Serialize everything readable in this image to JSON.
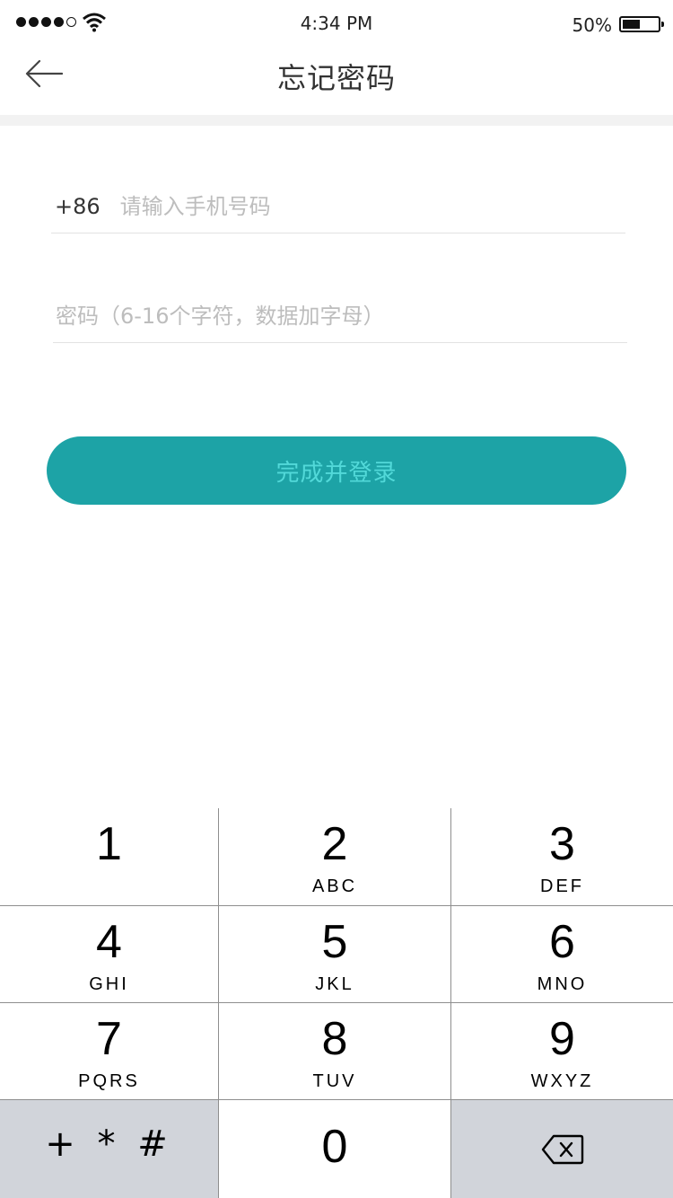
{
  "status_bar": {
    "time": "4:34 PM",
    "battery_percent": "50%",
    "battery_level": 0.5,
    "signal_bars_filled": 4,
    "signal_bars_total": 5
  },
  "nav": {
    "title": "忘记密码",
    "back_icon": "arrow-left-icon"
  },
  "form": {
    "phone_prefix": "+86",
    "phone_placeholder": "请输入手机号码",
    "phone_value": "",
    "password_placeholder": "密码（6-16个字符，数据加字母）",
    "password_value": "",
    "submit_label": "完成并登录"
  },
  "keypad": {
    "keys": [
      {
        "num": "1",
        "letters": ""
      },
      {
        "num": "2",
        "letters": "ABC"
      },
      {
        "num": "3",
        "letters": "DEF"
      },
      {
        "num": "4",
        "letters": "GHI"
      },
      {
        "num": "5",
        "letters": "JKL"
      },
      {
        "num": "6",
        "letters": "MNO"
      },
      {
        "num": "7",
        "letters": "PQRS"
      },
      {
        "num": "8",
        "letters": "TUV"
      },
      {
        "num": "9",
        "letters": "WXYZ"
      }
    ],
    "symbols_label": "+ * #",
    "zero": "0",
    "delete_icon": "backspace-icon"
  },
  "colors": {
    "accent": "#1da3a6",
    "button_text": "#52d9d9",
    "keypad_gray": "#d1d4da"
  }
}
